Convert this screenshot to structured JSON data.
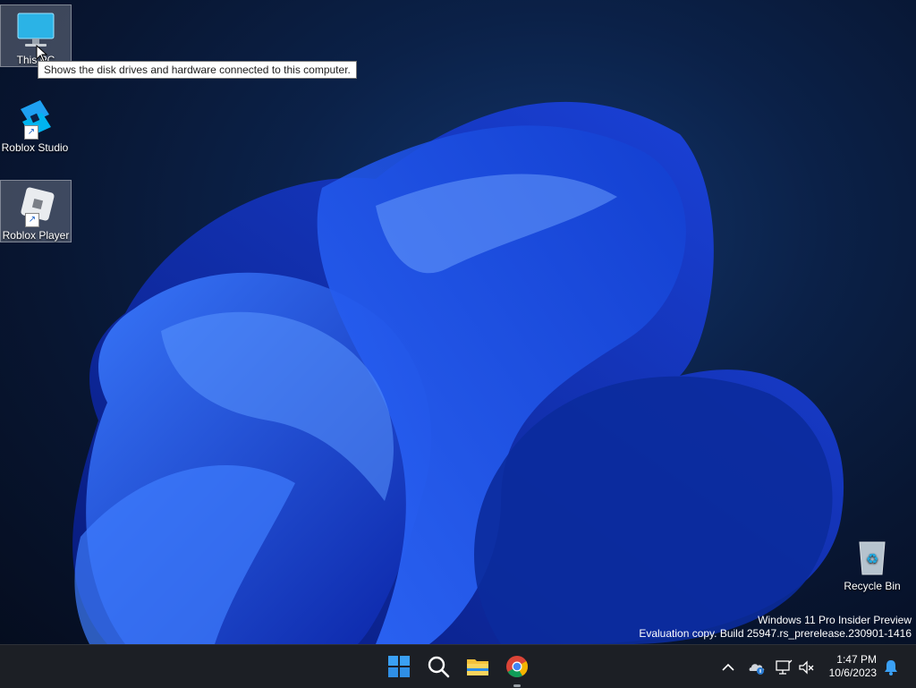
{
  "desktop": {
    "icons": [
      {
        "label": "This PC",
        "icon": "monitor-icon"
      },
      {
        "label": "Roblox Studio",
        "icon": "roblox-studio-icon"
      },
      {
        "label": "Roblox Player",
        "icon": "roblox-player-icon"
      },
      {
        "label": "Recycle Bin",
        "icon": "recycle-bin-icon"
      }
    ],
    "tooltip": "Shows the disk drives and hardware connected to this computer.",
    "watermark": {
      "line1": "Windows 11 Pro Insider Preview",
      "line2": "Evaluation copy. Build 25947.rs_prerelease.230901-1416"
    }
  },
  "taskbar": {
    "apps": [
      {
        "name": "start-icon"
      },
      {
        "name": "search-icon"
      },
      {
        "name": "file-explorer-icon"
      },
      {
        "name": "chrome-icon",
        "running": true
      }
    ],
    "tray": [
      "chevron-up-icon",
      "onedrive-icon",
      "network-icon",
      "volume-muted-icon"
    ],
    "clock": {
      "time": "1:47 PM",
      "date": "10/6/2023"
    },
    "notification_icon": "bell-icon"
  },
  "colors": {
    "taskbar_bg": "#1c1f25",
    "accent": "#1a73e8",
    "wallpaper_blue": "#1f52e8"
  }
}
